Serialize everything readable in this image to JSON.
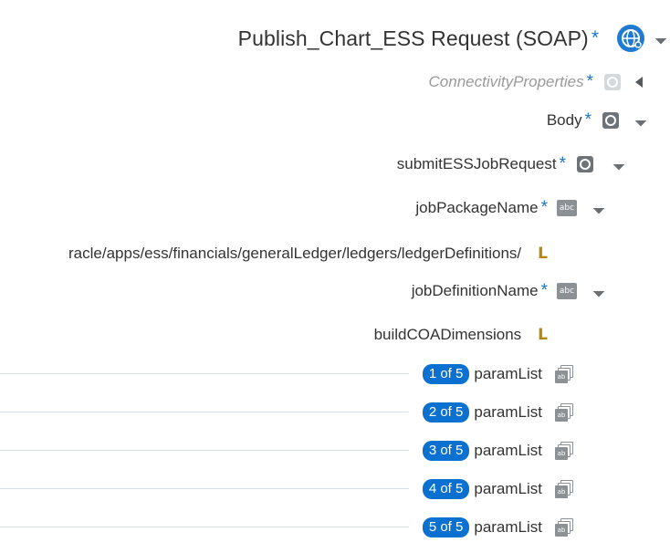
{
  "root": {
    "title": "Publish_Chart_ESS Request (SOAP)",
    "required_mark": "*"
  },
  "nodes": {
    "connectivity": {
      "label": "ConnectivityProperties",
      "required_mark": "*"
    },
    "body": {
      "label": "Body",
      "required_mark": "*"
    },
    "submit": {
      "label": "submitESSJobRequest",
      "required_mark": "*"
    },
    "job_package": {
      "label": "jobPackageName",
      "required_mark": "*",
      "type_icon_text": "abc"
    },
    "job_package_value": {
      "value": "racle/apps/ess/financials/generalLedger/ledgers/ledgerDefinitions/"
    },
    "job_definition": {
      "label": "jobDefinitionName",
      "required_mark": "*",
      "type_icon_text": "abc"
    },
    "job_definition_value": {
      "value": "buildCOADimensions"
    }
  },
  "literal_icon_text": "L",
  "param_list": {
    "label": "paramList",
    "icon_text": "ab",
    "items": [
      {
        "badge": "1 of 5"
      },
      {
        "badge": "2 of 5"
      },
      {
        "badge": "3 of 5"
      },
      {
        "badge": "4 of 5"
      },
      {
        "badge": "5 of 5"
      }
    ]
  }
}
